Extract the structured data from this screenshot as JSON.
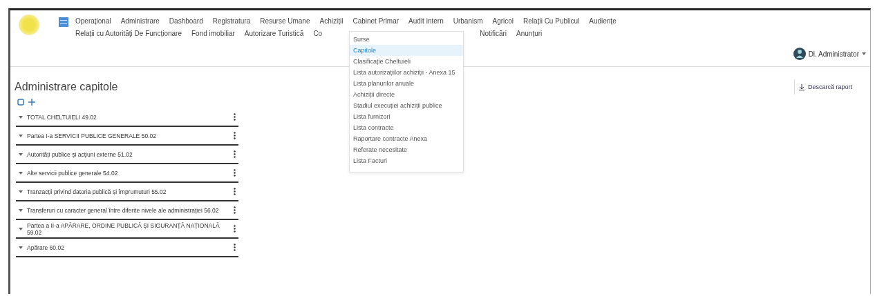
{
  "menu_rows": [
    [
      "Operațional",
      "Administrare",
      "Dashboard",
      "Registratura",
      "Resurse Umane",
      "Achiziții",
      "Cabinet Primar",
      "Audit intern",
      "Urbanism",
      "Agricol",
      "Relații Cu Publicul",
      "Audiențe"
    ],
    [
      "Relații cu Autorități De Funcționare",
      "Fond imobiliar",
      "Autorizare Turistică",
      "Co",
      "Notificări",
      "Anunțuri"
    ]
  ],
  "dropdown": {
    "items": [
      {
        "label": "Surse",
        "selected": false
      },
      {
        "label": "Capitole",
        "selected": true
      },
      {
        "label": "Clasificație Cheltuieli",
        "selected": false
      },
      {
        "label": "Lista autorizațiilor achiziții - Anexa 15",
        "selected": false
      },
      {
        "label": "Lista planurilor anuale",
        "selected": false
      },
      {
        "label": "Achiziții directe",
        "selected": false
      },
      {
        "label": "Stadiul execuției achiziții publice",
        "selected": false
      },
      {
        "label": "Lista furnizori",
        "selected": false
      },
      {
        "label": "Lista contracte",
        "selected": false
      },
      {
        "label": "Raportare contracte Anexa",
        "selected": false
      },
      {
        "label": "Referate necesitate",
        "selected": false
      },
      {
        "label": "Lista Facturi",
        "selected": false
      }
    ]
  },
  "user": {
    "name": "Dl. Administrator"
  },
  "page": {
    "title": "Administrare capitole",
    "action": "Descarcă raport"
  },
  "tree": [
    {
      "label": "TOTAL CHELTUIELI 49.02",
      "expanded": true
    },
    {
      "label": "Partea I-a SERVICII PUBLICE GENERALE 50.02",
      "expanded": true
    },
    {
      "label": "Autorități publice și acțiuni externe 51.02",
      "expanded": true
    },
    {
      "label": "Alte servicii publice generale 54.02",
      "expanded": true
    },
    {
      "label": "Tranzacții privind datoria publică și împrumuturi 55.02",
      "expanded": true
    },
    {
      "label": "Transferuri cu caracter general între diferite nivele ale administrației 56.02",
      "expanded": true
    },
    {
      "label": "Partea a II-a APĂRARE, ORDINE PUBLICĂ ȘI SIGURANȚĂ NAȚIONALĂ 59.02",
      "expanded": true
    },
    {
      "label": "Apărare 60.02",
      "expanded": true
    }
  ]
}
